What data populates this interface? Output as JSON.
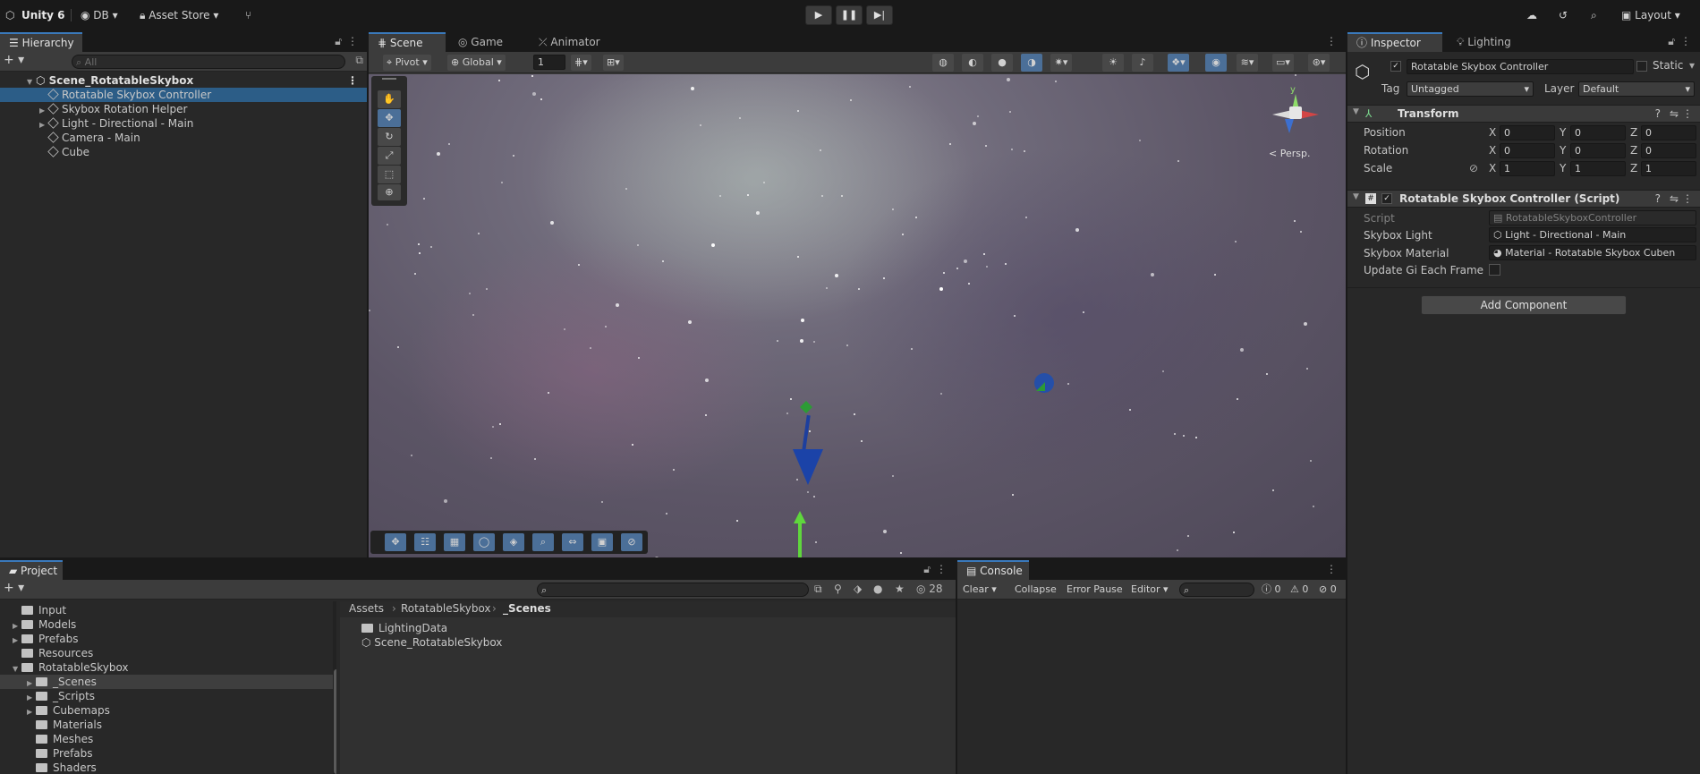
{
  "topbar": {
    "app_title": "Unity 6",
    "account": "DB",
    "asset_store": "Asset Store",
    "layout": "Layout"
  },
  "hierarchy": {
    "tab": "Hierarchy",
    "search_placeholder": "All",
    "scene_name": "Scene_RotatableSkybox",
    "items": [
      {
        "label": "Rotatable Skybox Controller",
        "selected": true,
        "expandable": false
      },
      {
        "label": "Skybox Rotation Helper",
        "selected": false,
        "expandable": true
      },
      {
        "label": "Light - Directional - Main",
        "selected": false,
        "expandable": true
      },
      {
        "label": "Camera - Main",
        "selected": false,
        "expandable": false
      },
      {
        "label": "Cube",
        "selected": false,
        "expandable": false
      }
    ]
  },
  "scene": {
    "tabs": [
      "Scene",
      "Game",
      "Animator"
    ],
    "pivot": "Pivot",
    "global": "Global",
    "grid_value": "1",
    "persp_label": "< Persp.",
    "gizmo_axis_y": "y"
  },
  "inspector": {
    "tabs": [
      "Inspector",
      "Lighting"
    ],
    "object_name": "Rotatable Skybox Controller",
    "static_label": "Static",
    "tag_label": "Tag",
    "tag_value": "Untagged",
    "layer_label": "Layer",
    "layer_value": "Default",
    "transform": {
      "title": "Transform",
      "rows": [
        {
          "label": "Position",
          "x": "0",
          "y": "0",
          "z": "0"
        },
        {
          "label": "Rotation",
          "x": "0",
          "y": "0",
          "z": "0"
        },
        {
          "label": "Scale",
          "x": "1",
          "y": "1",
          "z": "1"
        }
      ]
    },
    "script_component": {
      "title": "Rotatable Skybox Controller (Script)",
      "script_label": "Script",
      "script_value": "RotatableSkyboxController",
      "light_label": "Skybox Light",
      "light_value": "Light - Directional - Main",
      "material_label": "Skybox Material",
      "material_value": "Material - Rotatable Skybox Cuben",
      "gi_label": "Update Gi Each Frame"
    },
    "add_component": "Add Component"
  },
  "project": {
    "tab": "Project",
    "hidden_count": "28",
    "breadcrumb": [
      "Assets",
      "RotatableSkybox",
      "_Scenes"
    ],
    "tree": [
      {
        "label": "Input",
        "indent": 1,
        "arrow": false,
        "selected": false
      },
      {
        "label": "Models",
        "indent": 1,
        "arrow": true,
        "selected": false
      },
      {
        "label": "Prefabs",
        "indent": 1,
        "arrow": true,
        "selected": false
      },
      {
        "label": "Resources",
        "indent": 1,
        "arrow": false,
        "selected": false
      },
      {
        "label": "RotatableSkybox",
        "indent": 1,
        "arrow": true,
        "open": true,
        "selected": false
      },
      {
        "label": "_Scenes",
        "indent": 2,
        "arrow": true,
        "selected": true
      },
      {
        "label": "_Scripts",
        "indent": 2,
        "arrow": true,
        "selected": false
      },
      {
        "label": "Cubemaps",
        "indent": 2,
        "arrow": true,
        "selected": false
      },
      {
        "label": "Materials",
        "indent": 2,
        "arrow": false,
        "selected": false
      },
      {
        "label": "Meshes",
        "indent": 2,
        "arrow": false,
        "selected": false
      },
      {
        "label": "Prefabs",
        "indent": 2,
        "arrow": false,
        "selected": false
      },
      {
        "label": "Shaders",
        "indent": 2,
        "arrow": false,
        "selected": false
      }
    ],
    "files": [
      {
        "label": "LightingData",
        "kind": "folder"
      },
      {
        "label": "Scene_RotatableSkybox",
        "kind": "scene"
      }
    ]
  },
  "console": {
    "tab": "Console",
    "clear": "Clear",
    "collapse": "Collapse",
    "error_pause": "Error Pause",
    "editor": "Editor",
    "log_count": "0",
    "warn_count": "0",
    "error_count": "0"
  },
  "colors": {
    "accent": "#3a79bb",
    "selection": "#2c5d87"
  }
}
